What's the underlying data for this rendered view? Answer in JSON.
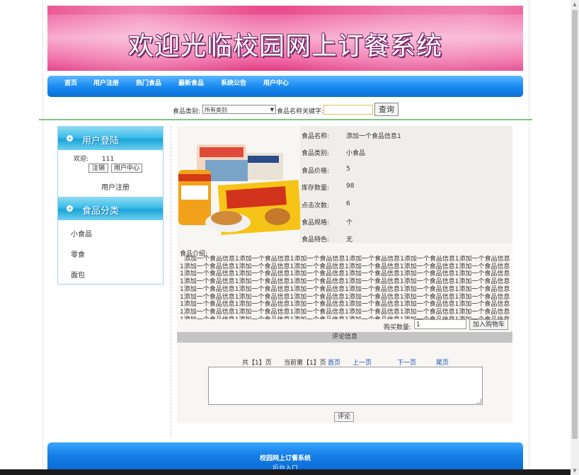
{
  "header": {
    "title": "欢迎光临校园网上订餐系统"
  },
  "nav": {
    "items": [
      "首页",
      "用户注册",
      "热门食品",
      "最新食品",
      "系统公告",
      "用户中心"
    ]
  },
  "search": {
    "category_label": "食品类别:",
    "category_value": "所有类别",
    "keyword_label": "食品名称关键字:",
    "keyword_value": "",
    "button": "查询"
  },
  "sidebar": {
    "login_title": "用户登陆",
    "welcome_label": "欢迎:",
    "username": "111",
    "logout_button": "注销",
    "user_center_button": "用户中心",
    "register_link": "用户注册",
    "category_title": "食品分类",
    "categories": [
      "小食品",
      "零食",
      "面包"
    ]
  },
  "product": {
    "fields": [
      {
        "key": "食品名称:",
        "value": "添加一个食品信息1"
      },
      {
        "key": "食品类别:",
        "value": "小食品"
      },
      {
        "key": "食品价格:",
        "value": "5"
      },
      {
        "key": "库存数量:",
        "value": "98"
      },
      {
        "key": "点击次数:",
        "value": "6"
      },
      {
        "key": "食品规格:",
        "value": "个"
      },
      {
        "key": "食品特色:",
        "value": "无"
      }
    ],
    "desc_label": "食品介绍:",
    "description": "添加一个食品信息1添加一个食品信息1添加一个食品信息1添加一个食品信息1添加一个食品信息1添加一个食品信息1添加一个食品信息1添加一个食品信息1添加一个食品信息1添加一个食品信息1添加一个食品信息1添加一个食品信息1添加一个食品信息1添加一个食品信息1添加一个食品信息1添加一个食品信息1添加一个食品信息1添加一个食品信息1添加一个食品信息1添加一个食品信息1添加一个食品信息1添加一个食品信息1添加一个食品信息1添加一个食品信息1添加一个食品信息1添加一个食品信息1添加一个食品信息1添加一个食品信息1添加一个食品信息1添加一个食品信息1添加一个食品信息1添加一个食品信息1添加一个食品信息1添加一个食品信息1添加一个食品信息1添加一个食品信息1添加一个食品信息1添加一个食品信息1添加一个食品信息1添加一个食品信息1添加一个食品信息1添加一个食品信息1添加一个食品信息1添加一个食品信息1添加一个食品信息1添加一个食品信息1添加一个食品信息1添加一个食品信息1添加一个食品信息1添加一个食品信息1添加一个食品信息1添加一个食品信息1添加一个食品信息1添加一个食品信息1添加一个食品信息1添加一个食品信息1添加一个食品信息1",
    "buy_label": "购买数量:",
    "buy_quantity": "1",
    "cart_button": "加入购物车"
  },
  "comments": {
    "title": "评论信息",
    "total_pages": "共【1】页",
    "current_page": "当前第【1】页",
    "first": "首页",
    "prev": "上一页",
    "next": "下一页",
    "last": "尾页",
    "submit": "评论"
  },
  "footer": {
    "title": "校园网上订餐系统",
    "admin_link": "后台入口"
  }
}
